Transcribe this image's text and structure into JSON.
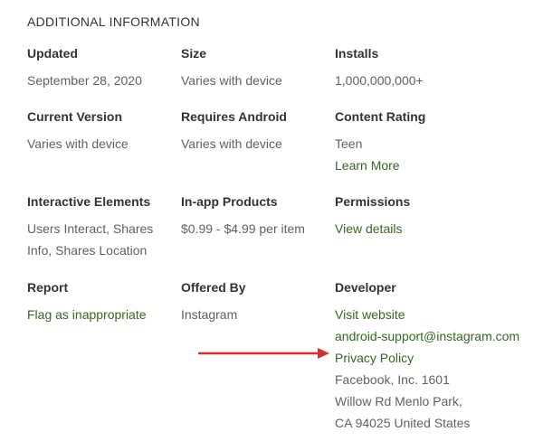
{
  "section": {
    "title": "ADDITIONAL INFORMATION"
  },
  "info": {
    "updated": {
      "label": "Updated",
      "values": [
        "September 28, 2020"
      ]
    },
    "size": {
      "label": "Size",
      "values": [
        "Varies with device"
      ]
    },
    "installs": {
      "label": "Installs",
      "values": [
        "1,000,000,000+"
      ]
    },
    "current_version": {
      "label": "Current Version",
      "values": [
        "Varies with device"
      ]
    },
    "requires_android": {
      "label": "Requires Android",
      "values": [
        "Varies with device"
      ]
    },
    "content_rating": {
      "label": "Content Rating",
      "values": [
        "Teen"
      ],
      "link": "Learn More"
    },
    "interactive_elements": {
      "label": "Interactive Elements",
      "values": [
        "Users Interact, Shares",
        "Info, Shares Location"
      ]
    },
    "in_app_products": {
      "label": "In-app Products",
      "values": [
        "$0.99 - $4.99 per item"
      ]
    },
    "permissions": {
      "label": "Permissions",
      "link": "View details"
    },
    "report": {
      "label": "Report",
      "link": "Flag as inappropriate"
    },
    "offered_by": {
      "label": "Offered By",
      "values": [
        "Instagram"
      ]
    },
    "developer": {
      "label": "Developer",
      "website_link": "Visit website",
      "email_link": "android-support@instagram.com",
      "privacy_link": "Privacy Policy",
      "address": [
        "Facebook, Inc. 1601",
        "Willow Rd Menlo Park,",
        "CA 94025 United States"
      ]
    }
  },
  "annotation": {
    "arrow_color": "#d32f2f"
  },
  "colors": {
    "link": "#33691e",
    "label": "#333333",
    "value": "#616161"
  }
}
